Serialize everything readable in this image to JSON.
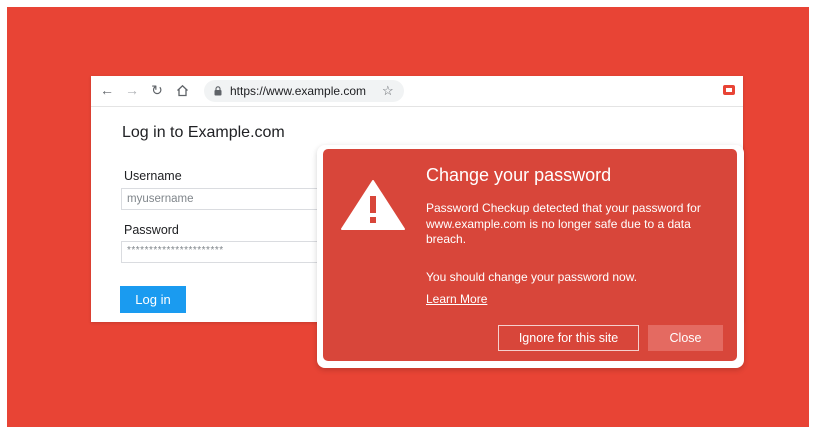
{
  "browser": {
    "url": "https://www.example.com",
    "nav": {
      "back_icon": "arrow-left-icon",
      "forward_icon": "arrow-right-icon",
      "reload_icon": "reload-icon",
      "home_icon": "home-icon"
    }
  },
  "page": {
    "heading": "Log in to Example.com",
    "username_label": "Username",
    "username_value": "myusername",
    "password_label": "Password",
    "password_value": "**********************",
    "login_button": "Log in"
  },
  "dialog": {
    "title": "Change your password",
    "body": "Password Checkup detected that your password for www.example.com is no longer safe due to a data breach.",
    "body2": "You should change your password now.",
    "link": "Learn More",
    "ignore_button": "Ignore for this site",
    "close_button": "Close",
    "icon": "warning-triangle-icon"
  },
  "colors": {
    "background": "#e84435",
    "dialog": "#d8463a",
    "login_button": "#1a9bf0",
    "close_button": "#e46a61"
  }
}
